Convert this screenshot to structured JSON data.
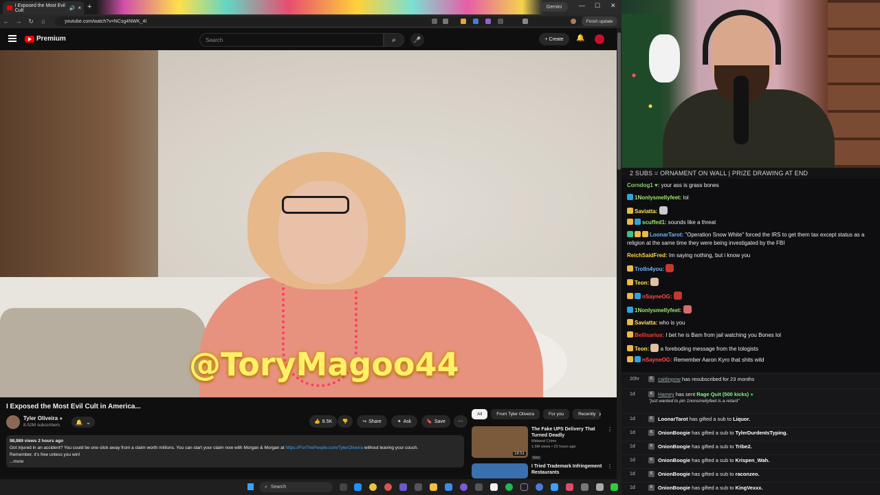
{
  "browser": {
    "tab_title": "I Exposed the Most Evil Cult",
    "gemini_label": "Gemini",
    "url": "youtube.com/watch?v=NCsg4NWK_4I",
    "finish_update": "Finish update"
  },
  "youtube": {
    "logo_text": "Premium",
    "search_placeholder": "Search",
    "create_label": "Create"
  },
  "video": {
    "watermark": "@ToryMagoo44",
    "title": "I Exposed the Most Evil Cult in America...",
    "channel": "Tyler Oliveira",
    "subscribers": "8.52M subscribers",
    "likes": "8.5K",
    "share_label": "Share",
    "ask_label": "Ask",
    "save_label": "Save",
    "description": {
      "meta": "98,989 views  2 hours ago",
      "line1_before": "Got injured in an accident? You could be one click away from a claim worth millions. You can start your claim now with Morgan & Morgan at ",
      "link": "https://ForThePeople.com/TylerOliveira",
      "line1_after": " without leaving your couch.",
      "line2": "Remember, it's free unless you win!",
      "more": "...more"
    }
  },
  "filters": [
    "All",
    "From Tyler Oliveira",
    "For you",
    "Recently"
  ],
  "recommendations": [
    {
      "title": "The Fake UPS Delivery That Turned Deadly",
      "channel": "Midwest Crime",
      "meta": "1.6M views • 22 hours ago",
      "duration": "18:51",
      "badge": "New",
      "thumb_color": "#7a5a3a"
    },
    {
      "title": "I Tried Trademark Infringement Restaurants",
      "channel": "",
      "meta": "",
      "duration": "",
      "badge": "",
      "thumb_color": "#3a6fb0"
    }
  ],
  "taskbar": {
    "search_label": "Search"
  },
  "chat": {
    "banner": "2 SUBS = ORNAMENT ON WALL | PRIZE DRAWING AT END",
    "messages": [
      {
        "user": "Corndog1 ♥:",
        "color": "#8fd16a",
        "text": "your ass is grass bones",
        "badges": []
      },
      {
        "user": "1Nonlysmellyfeet:",
        "color": "#9fe870",
        "text": "lol",
        "badges": [
          "cube"
        ]
      },
      {
        "user": "Saviatta:",
        "color": "#ffe65c",
        "text": "",
        "badges": [
          "gift"
        ],
        "emote": "#cccccc"
      },
      {
        "user": "scuffed1:",
        "color": "#9fe870",
        "text": "sounds like a threat",
        "badges": [
          "gift",
          "cube"
        ]
      },
      {
        "user": "LoonarTarot:",
        "color": "#6fb8ff",
        "text": "\"Operation Snow White\" forced the IRS to get them tax except status as a religion at the same time they were being investigated by the FBI",
        "badges": [
          "sub",
          "gift",
          "gift"
        ]
      },
      {
        "user": "ReichSaidFred:",
        "color": "#ffd94a",
        "text": "Im saying nothing, but i know you",
        "badges": []
      },
      {
        "user": "Trolln4you:",
        "color": "#6fb8ff",
        "text": "",
        "badges": [
          "gift"
        ],
        "emote": "#c0392b"
      },
      {
        "user": "Teon:",
        "color": "#ffe65c",
        "text": "",
        "badges": [
          "gift"
        ],
        "emote": "#e0c0a0"
      },
      {
        "user": "nSayneOG:",
        "color": "#ff4d4d",
        "text": "",
        "badges": [
          "gift",
          "cube"
        ],
        "emote": "#c0392b"
      },
      {
        "user": "1Nonlysmellyfeet:",
        "color": "#9fe870",
        "text": "",
        "badges": [
          "cube"
        ],
        "emote": "#d96b6b"
      },
      {
        "user": "Saviatta:",
        "color": "#ffe65c",
        "text": "who is you",
        "badges": [
          "gift"
        ]
      },
      {
        "user": "Bellisarius:",
        "color": "#ff3b3b",
        "text": "I bet he is Bam from jail watching you Bones lol",
        "badges": [
          "gift"
        ]
      },
      {
        "user": "Teon:",
        "color": "#ffe65c",
        "text": "a foreboding message from the tologists",
        "badges": [
          "gift"
        ],
        "emote": "#e0c0a0"
      },
      {
        "user": "nSayneOG:",
        "color": "#ff4d4d",
        "text": "Remember Aaron Kyro that shits wild",
        "badges": [
          "gift",
          "cube"
        ]
      }
    ]
  },
  "events": [
    {
      "time": "20hr",
      "user": "caitlinpnw",
      "muted": true,
      "text": " has resubscribed for 23 months"
    },
    {
      "time": "1d",
      "user": "Hamey",
      "muted": true,
      "text": " has sent ",
      "green": "Rage Quit (500 kicks)",
      "quote": "\"just wanted to pin 1nonsmellyfeet is a retard\""
    },
    {
      "time": "1d",
      "user": "LoonarTarot",
      "text": " has gifted a sub to ",
      "target": "Liquor."
    },
    {
      "time": "1d",
      "user": "OnionBoogie",
      "text": " has gifted a sub to ",
      "target": "TylerDurdenIsTyping."
    },
    {
      "time": "1d",
      "user": "OnionBoogie",
      "text": " has gifted a sub to ",
      "target": "Tribe2."
    },
    {
      "time": "1d",
      "user": "OnionBoogie",
      "text": " has gifted a sub to ",
      "target": "Krispen_Wah."
    },
    {
      "time": "1d",
      "user": "OnionBoogie",
      "text": " has gifted a sub to ",
      "target": "raconzeo."
    },
    {
      "time": "1d",
      "user": "OnionBoogie",
      "text": " has gifted a sub to ",
      "target": "KingVexxx."
    }
  ]
}
